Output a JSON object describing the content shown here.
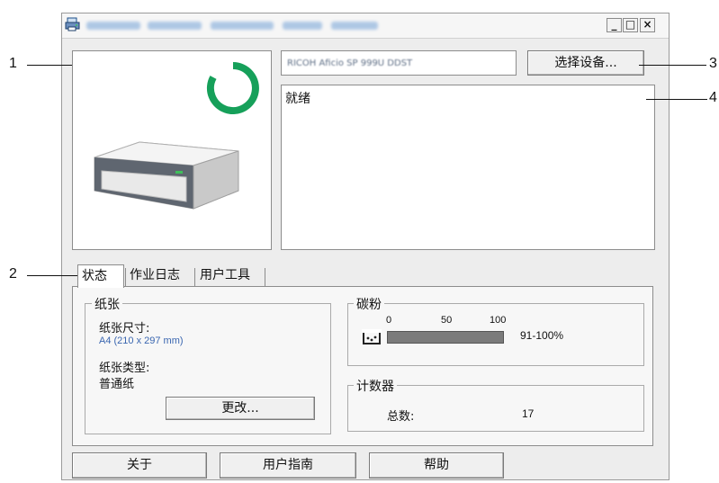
{
  "callouts": [
    "1",
    "2",
    "3",
    "4"
  ],
  "device": {
    "name": "RICOH Aficio SP 999U DDST",
    "status": "就绪"
  },
  "buttons": {
    "select_device": "选择设备...",
    "change": "更改...",
    "about": "关于",
    "user_guide": "用户指南",
    "help": "帮助"
  },
  "window_controls": {
    "minimize": "_",
    "maximize": "□",
    "close": "×"
  },
  "tabs": [
    "状态",
    "作业日志",
    "用户工具"
  ],
  "paper": {
    "group_label": "纸张",
    "size_label": "纸张尺寸:",
    "size_value": "A4 (210 x 297 mm)",
    "type_label": "纸张类型:",
    "type_value": "普通纸"
  },
  "toner": {
    "group_label": "碳粉",
    "scale": [
      "0",
      "50",
      "100"
    ],
    "level_text": "91-100%",
    "level_fraction": 1.0
  },
  "counter": {
    "group_label": "计数器",
    "total_label": "总数:",
    "total_value": "17"
  },
  "colors": {
    "spinner": "#16a05a",
    "link_blue": "#3a66b0",
    "toner_bar": "#7b7b7b"
  },
  "icons": [
    "printer-app-icon",
    "loading-spinner-icon",
    "printer-image",
    "toner-icon"
  ]
}
